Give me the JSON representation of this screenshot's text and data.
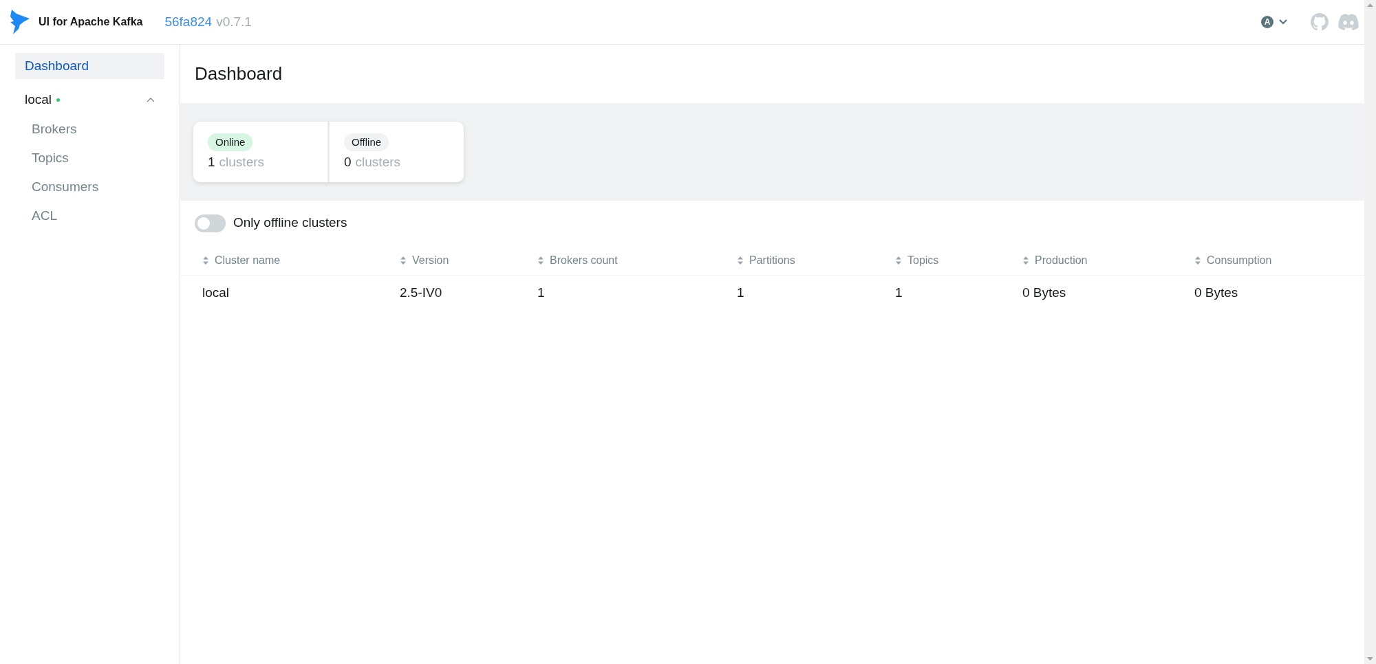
{
  "header": {
    "title": "UI for Apache Kafka",
    "commit": "56fa824",
    "version": "v0.7.1",
    "user_initial": "A"
  },
  "sidebar": {
    "items": [
      {
        "label": "Dashboard",
        "selected": true
      },
      {
        "label": "local",
        "selected": false,
        "online": true,
        "expanded": true,
        "children": [
          {
            "label": "Brokers",
            "selected": false
          },
          {
            "label": "Topics",
            "selected": false
          },
          {
            "label": "Consumers",
            "selected": false
          },
          {
            "label": "ACL",
            "selected": false
          }
        ]
      }
    ]
  },
  "page": {
    "title": "Dashboard"
  },
  "stats": [
    {
      "kind": "online",
      "label": "Online",
      "count": "1",
      "unit": "clusters"
    },
    {
      "kind": "offline",
      "label": "Offline",
      "count": "0",
      "unit": "clusters"
    }
  ],
  "toggle": {
    "label": "Only offline clusters",
    "on": false
  },
  "table": {
    "columns": [
      "Cluster name",
      "Version",
      "Brokers count",
      "Partitions",
      "Topics",
      "Production",
      "Consumption"
    ],
    "rows": [
      [
        "local",
        "2.5-IV0",
        "1",
        "1",
        "1",
        "0 Bytes",
        "0 Bytes"
      ]
    ]
  }
}
